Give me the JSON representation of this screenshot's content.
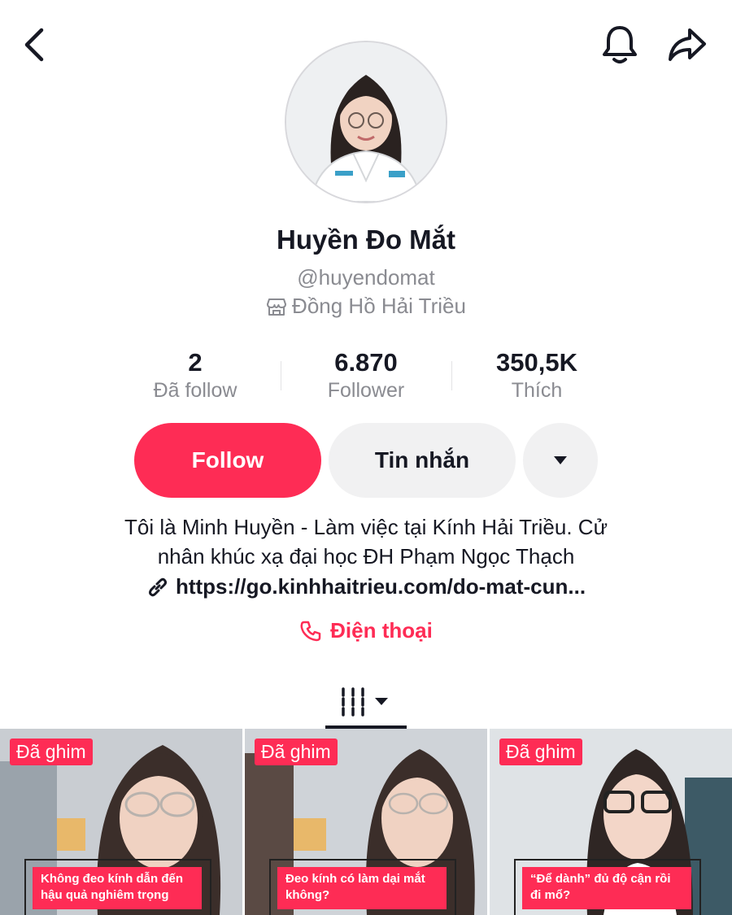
{
  "profile": {
    "name": "Huyền Đo Mắt",
    "handle": "@huyendomat",
    "location": "Đồng Hồ Hải Triều"
  },
  "stats": [
    {
      "value": "2",
      "label": "Đã follow"
    },
    {
      "value": "6.870",
      "label": "Follower"
    },
    {
      "value": "350,5K",
      "label": "Thích"
    }
  ],
  "actions": {
    "follow_label": "Follow",
    "message_label": "Tin nhắn"
  },
  "bio": {
    "line1": "Tôi là Minh Huyền - Làm việc tại Kính Hải Triều. Cử",
    "line2": "nhân khúc xạ đại học ĐH Phạm Ngọc Thạch",
    "link": "https://go.kinhhaitrieu.com/do-mat-cun...",
    "phone_label": "Điện thoại"
  },
  "icons": {
    "back": "chevron-left-icon",
    "bell": "bell-icon",
    "share": "share-icon",
    "shop": "shop-icon",
    "link": "link-icon",
    "phone": "phone-icon",
    "grid": "grid-icon",
    "caret": "caret-down-icon"
  },
  "colors": {
    "accent": "#fe2c55",
    "text": "#161823",
    "muted": "#8a8b91",
    "pill": "#f1f1f2"
  },
  "videos": [
    {
      "pin": "Đã ghim",
      "caption": "Không đeo kính dẫn đến hậu quả nghiêm trọng"
    },
    {
      "pin": "Đã ghim",
      "caption": "Đeo kính có làm dại mắt không?"
    },
    {
      "pin": "Đã ghim",
      "caption": "“Để dành” đủ độ cận rồi đi mổ?"
    }
  ]
}
